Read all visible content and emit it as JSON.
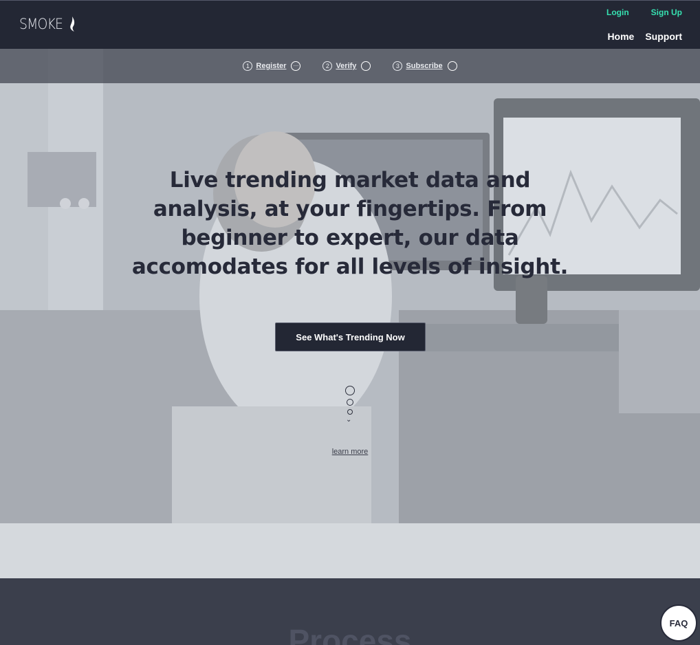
{
  "header": {
    "logo_text": "SMOKE",
    "auth": {
      "login": "Login",
      "signup": "Sign Up"
    },
    "nav": {
      "home": "Home",
      "support": "Support"
    }
  },
  "steps": [
    {
      "number": "1",
      "label": "Register",
      "status_icon": "ellipsis-circle-icon",
      "status_glyph": "···"
    },
    {
      "number": "2",
      "label": "Verify",
      "status_icon": "empty-circle-icon",
      "status_glyph": ""
    },
    {
      "number": "3",
      "label": "Subscribe",
      "status_icon": "empty-circle-icon",
      "status_glyph": ""
    }
  ],
  "hero": {
    "headline": "Live trending market data and analysis, at your fingertips. From beginner to expert, our data accomodates for all levels of insight.",
    "cta_label": "See What's Trending Now",
    "learn_more": "learn more"
  },
  "process": {
    "title": "Process"
  },
  "faq_label": "FAQ",
  "colors": {
    "header_bg": "#232734",
    "accent": "#36e0b0",
    "headline": "#272a39",
    "band": "#d5d9dd",
    "section_dark": "#3b3f4c"
  }
}
